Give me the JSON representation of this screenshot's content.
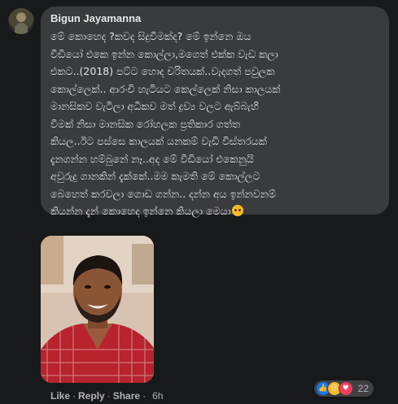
{
  "comment": {
    "author": "Bigun Jayamanna",
    "lines": [
      "මේ කොහෙද ?කවද සිදුවීමක්ද? මේ ඉන්නෙ ඔය",
      "වීඩියෝ එකෙ ඉන්න කොල්ලා,මගෙත් එක්ක වැඩ කලා",
      "එකට..(2018) පට්ට හොද චරිතයක්..වැදගත් පවුලක",
      "කොල්ලෙක්.. ආරංචි හැටියට කෙල්ලෙක් නිසා කාලයක්",
      "මානසිකව වැටිලා අධිකව මත් ද්‍රව්‍ය වලට ඇබ්බැහි",
      "වීමක් නිසා මානසික රෝහලක ප්‍රතිකාර ගත්ත",
      "කියල..ඊට පස්සෙ කාලයක් යනකම් වැඩි විස්තරයක්",
      "දැනගන්න හම්බුනේ නෑ..අද මේ වීඩියෝ එකෙනුයි",
      "අවුරුදු ගානකින් දැක්කේ..මම කැමති මේ කොල්ලට",
      "බෙහෙත් කරවලා ගොඩ ගන්න.. දන්න අය ඉන්නවනම්",
      "කියන්න දැන් කොහෙද ඉන්නෙ කියලා මෙයා"
    ],
    "trailing_emoji": "sad-face-emoji"
  },
  "actions": {
    "like": "Like",
    "reply": "Reply",
    "share": "Share",
    "separator": "·",
    "timestamp": "6h"
  },
  "reactions": {
    "icons": [
      "like-reaction",
      "sad-reaction",
      "love-reaction"
    ],
    "count": "22"
  },
  "colors": {
    "background": "#18191a",
    "bubble": "#3a3b3c",
    "text": "#e4e6eb",
    "secondary_text": "#b0b3b8"
  }
}
